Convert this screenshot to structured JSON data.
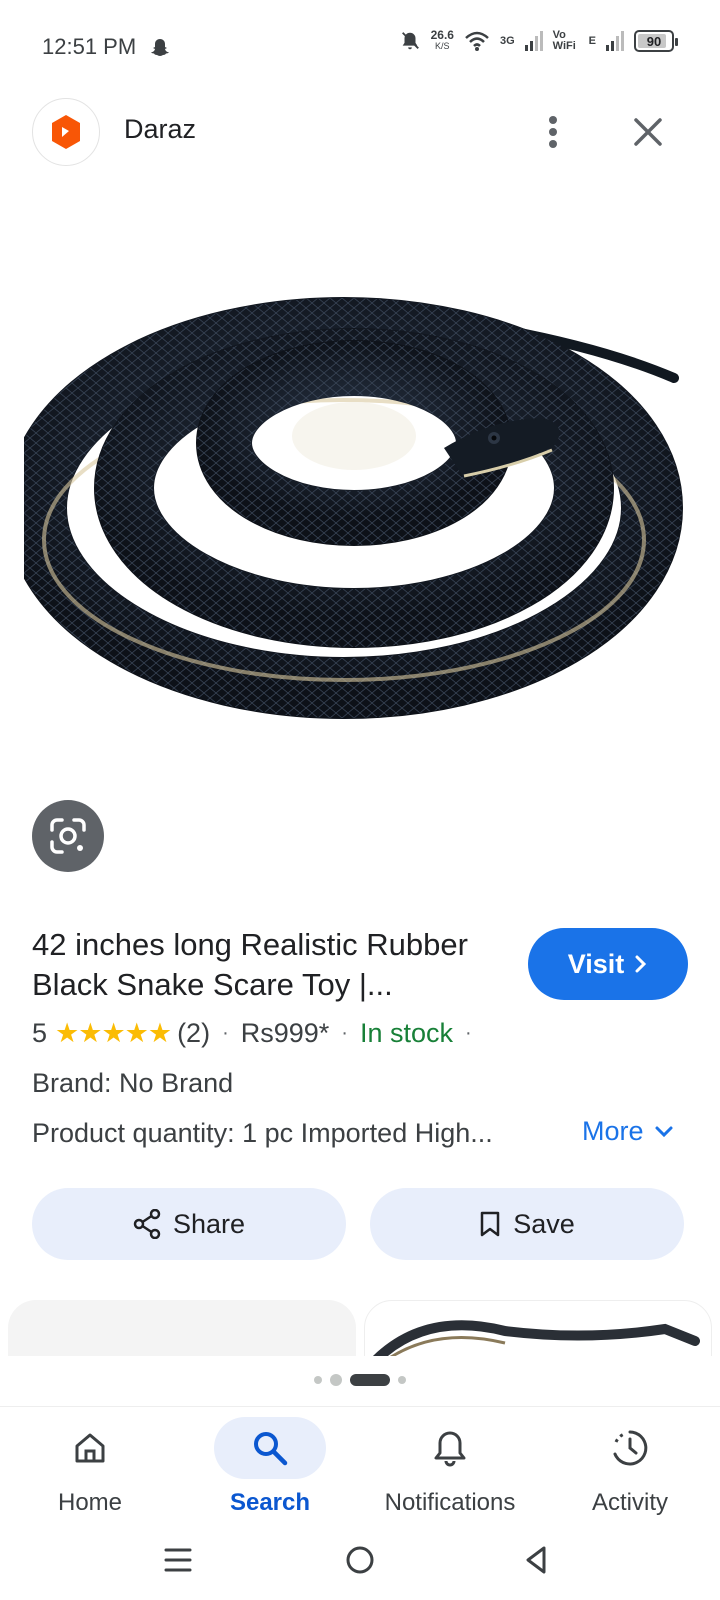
{
  "status_bar": {
    "time": "12:51 PM",
    "speed_value": "26.6",
    "speed_unit": "K/S",
    "net_3g": "3G",
    "net_vowifi": "Vo WiFi",
    "net_e": "E",
    "battery": "90",
    "battery_level": 0.9
  },
  "header": {
    "site_name": "Daraz",
    "logo_color": "#f85606"
  },
  "product": {
    "title": "42 inches long Realistic Rubber Black Snake Scare Toy |...",
    "visit_label": "Visit",
    "rating_value": "5",
    "stars": "★★★★★",
    "review_count": "(2)",
    "price": "Rs999*",
    "stock": "In stock",
    "separator": "·",
    "brand": "Brand: No Brand",
    "quantity": "Product quantity: 1 pc Imported High...",
    "more_label": "More"
  },
  "actions": {
    "share_label": "Share",
    "save_label": "Save"
  },
  "bottom_nav": {
    "items": [
      {
        "label": "Home",
        "icon": "home-icon"
      },
      {
        "label": "Search",
        "icon": "search-icon",
        "active": true
      },
      {
        "label": "Notifications",
        "icon": "bell-icon"
      },
      {
        "label": "Activity",
        "icon": "activity-icon"
      }
    ]
  },
  "colors": {
    "accent": "#1a73e8",
    "in_stock": "#188038",
    "star": "#fbbc04",
    "pill_bg": "#e8eefb"
  }
}
